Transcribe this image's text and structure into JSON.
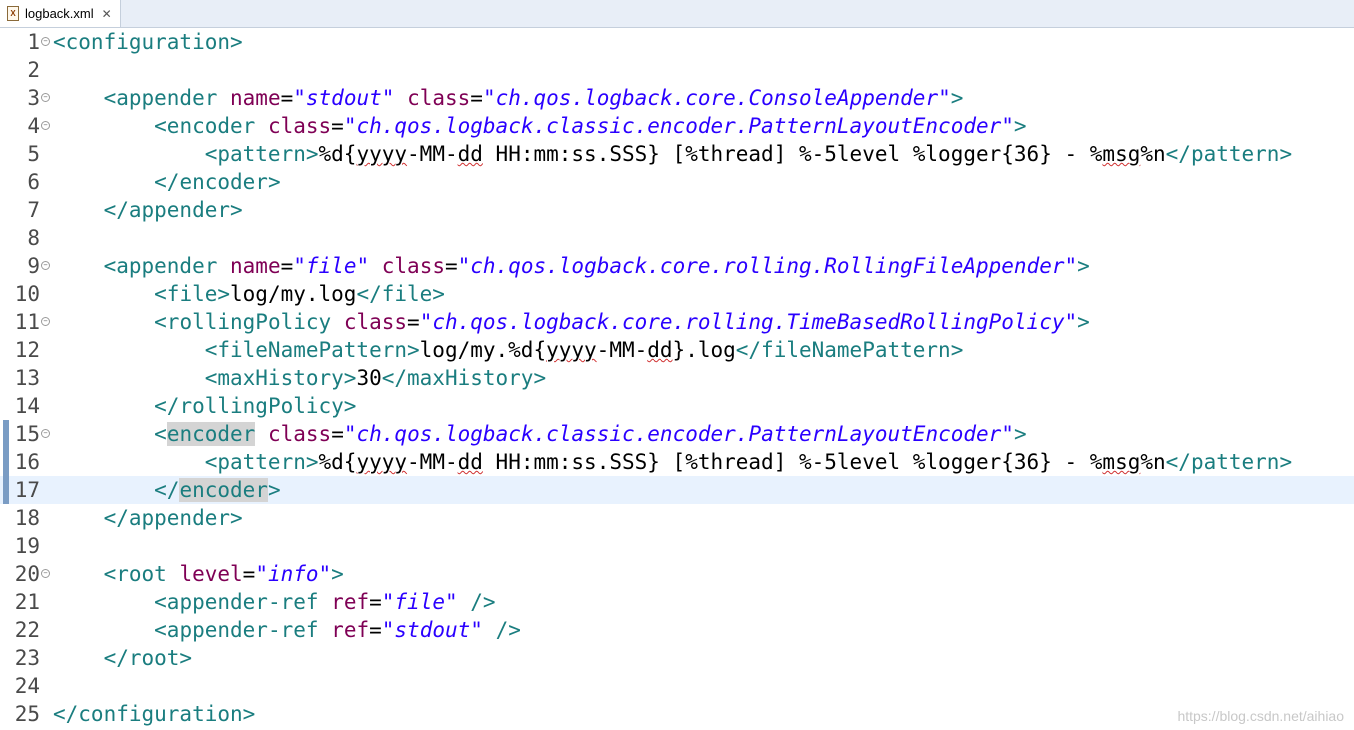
{
  "tab": {
    "title": "logback.xml",
    "close_glyph": "✕",
    "icon": "xml-file-icon"
  },
  "watermark": "https://blog.csdn.net/aihiao",
  "current_line": 17,
  "lines": [
    {
      "n": "1",
      "fold": true,
      "tokens": [
        [
          "t",
          "<configuration>"
        ]
      ]
    },
    {
      "n": "2",
      "tokens": []
    },
    {
      "n": "3",
      "fold": true,
      "tokens": [
        [
          "x",
          "    "
        ],
        [
          "t",
          "<appender "
        ],
        [
          "a",
          "name"
        ],
        [
          "e",
          "="
        ],
        [
          "s",
          "\"stdout\""
        ],
        [
          "x",
          " "
        ],
        [
          "a",
          "class"
        ],
        [
          "e",
          "="
        ],
        [
          "s",
          "\"ch.qos.logback.core.ConsoleAppender\""
        ],
        [
          "t",
          ">"
        ]
      ]
    },
    {
      "n": "4",
      "fold": true,
      "tokens": [
        [
          "x",
          "        "
        ],
        [
          "t",
          "<encoder "
        ],
        [
          "a",
          "class"
        ],
        [
          "e",
          "="
        ],
        [
          "s",
          "\"ch.qos.logback.classic.encoder.PatternLayoutEncoder\""
        ],
        [
          "t",
          ">"
        ]
      ]
    },
    {
      "n": "5",
      "tokens": [
        [
          "x",
          "            "
        ],
        [
          "t",
          "<pattern>"
        ],
        [
          "x",
          "%d{"
        ],
        [
          "sq",
          "yyyy"
        ],
        [
          "x",
          "-MM-"
        ],
        [
          "sq",
          "dd"
        ],
        [
          "x",
          " HH:mm:ss.SSS} [%thread] %-5level %logger{36} - %"
        ],
        [
          "sq",
          "msg"
        ],
        [
          "x",
          "%n"
        ],
        [
          "t",
          "</pattern>"
        ]
      ]
    },
    {
      "n": "6",
      "tokens": [
        [
          "x",
          "        "
        ],
        [
          "t",
          "</encoder>"
        ]
      ]
    },
    {
      "n": "7",
      "tokens": [
        [
          "x",
          "    "
        ],
        [
          "t",
          "</appender>"
        ]
      ]
    },
    {
      "n": "8",
      "tokens": []
    },
    {
      "n": "9",
      "fold": true,
      "tokens": [
        [
          "x",
          "    "
        ],
        [
          "t",
          "<appender "
        ],
        [
          "a",
          "name"
        ],
        [
          "e",
          "="
        ],
        [
          "s",
          "\"file\""
        ],
        [
          "x",
          " "
        ],
        [
          "a",
          "class"
        ],
        [
          "e",
          "="
        ],
        [
          "s",
          "\"ch.qos.logback.core.rolling.RollingFileAppender\""
        ],
        [
          "t",
          ">"
        ]
      ]
    },
    {
      "n": "10",
      "tokens": [
        [
          "x",
          "        "
        ],
        [
          "t",
          "<file>"
        ],
        [
          "x",
          "log/my.log"
        ],
        [
          "t",
          "</file>"
        ]
      ]
    },
    {
      "n": "11",
      "fold": true,
      "tokens": [
        [
          "x",
          "        "
        ],
        [
          "t",
          "<rollingPolicy "
        ],
        [
          "a",
          "class"
        ],
        [
          "e",
          "="
        ],
        [
          "s",
          "\"ch.qos.logback.core.rolling.TimeBasedRollingPolicy\""
        ],
        [
          "t",
          ">"
        ]
      ]
    },
    {
      "n": "12",
      "tokens": [
        [
          "x",
          "            "
        ],
        [
          "t",
          "<fileNamePattern>"
        ],
        [
          "x",
          "log/my.%d{"
        ],
        [
          "sq",
          "yyyy"
        ],
        [
          "x",
          "-MM-"
        ],
        [
          "sq",
          "dd"
        ],
        [
          "x",
          "}.log"
        ],
        [
          "t",
          "</fileNamePattern>"
        ]
      ]
    },
    {
      "n": "13",
      "tokens": [
        [
          "x",
          "            "
        ],
        [
          "t",
          "<maxHistory>"
        ],
        [
          "x",
          "30"
        ],
        [
          "t",
          "</maxHistory>"
        ]
      ]
    },
    {
      "n": "14",
      "tokens": [
        [
          "x",
          "        "
        ],
        [
          "t",
          "</rollingPolicy>"
        ]
      ]
    },
    {
      "n": "15",
      "fold": true,
      "change": true,
      "tokens": [
        [
          "x",
          "        "
        ],
        [
          "t",
          "<"
        ],
        [
          "thl",
          "encoder"
        ],
        [
          "t",
          " "
        ],
        [
          "a",
          "class"
        ],
        [
          "e",
          "="
        ],
        [
          "s",
          "\"ch.qos.logback.classic.encoder.PatternLayoutEncoder\""
        ],
        [
          "t",
          ">"
        ]
      ]
    },
    {
      "n": "16",
      "change": true,
      "tokens": [
        [
          "x",
          "            "
        ],
        [
          "t",
          "<pattern>"
        ],
        [
          "x",
          "%d{"
        ],
        [
          "sq",
          "yyyy"
        ],
        [
          "x",
          "-MM-"
        ],
        [
          "sq",
          "dd"
        ],
        [
          "x",
          " HH:mm:ss.SSS} [%thread] %-5level %logger{36} - %"
        ],
        [
          "sq",
          "msg"
        ],
        [
          "x",
          "%n"
        ],
        [
          "t",
          "</pattern>"
        ]
      ]
    },
    {
      "n": "17",
      "change": true,
      "tokens": [
        [
          "x",
          "        "
        ],
        [
          "t",
          "</"
        ],
        [
          "thl",
          "encoder"
        ],
        [
          "t",
          ">"
        ]
      ]
    },
    {
      "n": "18",
      "tokens": [
        [
          "x",
          "    "
        ],
        [
          "t",
          "</appender>"
        ]
      ]
    },
    {
      "n": "19",
      "tokens": []
    },
    {
      "n": "20",
      "fold": true,
      "tokens": [
        [
          "x",
          "    "
        ],
        [
          "t",
          "<root "
        ],
        [
          "a",
          "level"
        ],
        [
          "e",
          "="
        ],
        [
          "s",
          "\"info\""
        ],
        [
          "t",
          ">"
        ]
      ]
    },
    {
      "n": "21",
      "tokens": [
        [
          "x",
          "        "
        ],
        [
          "t",
          "<appender-ref "
        ],
        [
          "a",
          "ref"
        ],
        [
          "e",
          "="
        ],
        [
          "s",
          "\"file\""
        ],
        [
          "x",
          " "
        ],
        [
          "t",
          "/>"
        ]
      ]
    },
    {
      "n": "22",
      "tokens": [
        [
          "x",
          "        "
        ],
        [
          "t",
          "<appender-ref "
        ],
        [
          "a",
          "ref"
        ],
        [
          "e",
          "="
        ],
        [
          "s",
          "\"stdout\""
        ],
        [
          "x",
          " "
        ],
        [
          "t",
          "/>"
        ]
      ]
    },
    {
      "n": "23",
      "tokens": [
        [
          "x",
          "    "
        ],
        [
          "t",
          "</root>"
        ]
      ]
    },
    {
      "n": "24",
      "tokens": []
    },
    {
      "n": "25",
      "tokens": [
        [
          "t",
          "</configuration>"
        ]
      ]
    }
  ]
}
